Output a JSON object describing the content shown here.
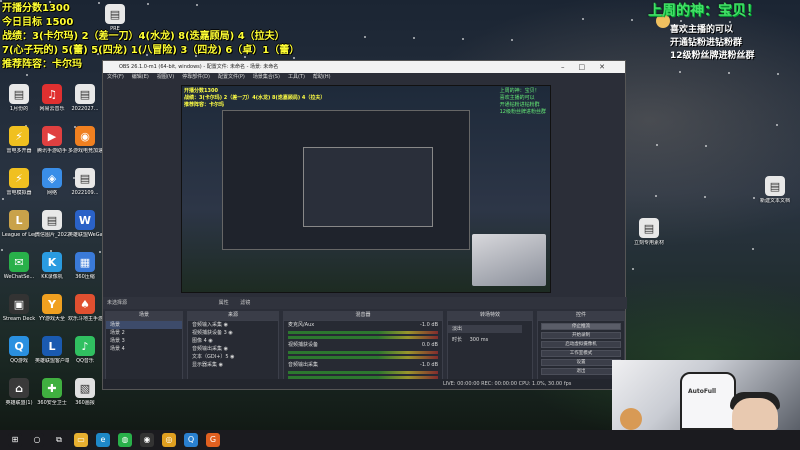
{
  "overlay": {
    "left_lines": [
      "开播分数1300",
      "今日目标 1500",
      "战绩：3(卡尔玛) 2（差一刀）4(水龙) 8(迭嘉顾局) 4（拉夫）",
      "7(心子玩的) 5(蕾) 5(四龙) 1(八冒险) 3（四龙) 6（卓）1（蕾）",
      "推荐阵容：卡尔玛"
    ],
    "right_title": "上周的神：宝贝！",
    "right_lines": [
      "喜欢主播的可以",
      "开通钻粉进钻粉群",
      "12级粉丝牌进粉丝群"
    ]
  },
  "desktop_icons": [
    {
      "label": "1月份的",
      "color": "#e8e8e8",
      "glyph": "▤"
    },
    {
      "label": "网易云音乐",
      "color": "#e03030",
      "glyph": "♫"
    },
    {
      "label": "2022027...",
      "color": "#e8e8e8",
      "glyph": "▤"
    },
    {
      "label": "雷电多开器",
      "color": "#f0c020",
      "glyph": "⚡"
    },
    {
      "label": "腾讯手游助手",
      "color": "#e04040",
      "glyph": "▶"
    },
    {
      "label": "多游戏电竞加速",
      "color": "#f08020",
      "glyph": "◉"
    },
    {
      "label": "雷电模拟器",
      "color": "#f0c020",
      "glyph": "⚡"
    },
    {
      "label": "网络",
      "color": "#3a8ee8",
      "glyph": "◈"
    },
    {
      "label": "2022109...",
      "color": "#e8e8e8",
      "glyph": "▤"
    },
    {
      "label": "League of Legends",
      "color": "#c9a24a",
      "glyph": "L"
    },
    {
      "label": "微信图片_20220...",
      "color": "#e8e8e8",
      "glyph": "▤"
    },
    {
      "label": "英雄联盟WeGame版",
      "color": "#2a62c8",
      "glyph": "W"
    },
    {
      "label": "WeChatSe...",
      "color": "#29b04a",
      "glyph": "✉"
    },
    {
      "label": "KK录像机",
      "color": "#2a9be0",
      "glyph": "K"
    },
    {
      "label": "360压缩",
      "color": "#3a7ad8",
      "glyph": "▦"
    },
    {
      "label": "Stream Deck",
      "color": "#333333",
      "glyph": "▣"
    },
    {
      "label": "YY游戏大全",
      "color": "#f0a020",
      "glyph": "Y"
    },
    {
      "label": "欢乐斗地主手游电脑版",
      "color": "#e05030",
      "glyph": "♠"
    },
    {
      "label": "QQ游戏",
      "color": "#2a90e0",
      "glyph": "Q"
    },
    {
      "label": "英雄联盟客户端",
      "color": "#1a5ab0",
      "glyph": "L"
    },
    {
      "label": "QQ音乐",
      "color": "#30c060",
      "glyph": "♪"
    },
    {
      "label": "英雄联盟(1)",
      "color": "#3a3a3a",
      "glyph": "⌂"
    },
    {
      "label": "360安全卫士",
      "color": "#40b040",
      "glyph": "✚"
    },
    {
      "label": "360画报",
      "color": "#e0e0e0",
      "glyph": "▧"
    }
  ],
  "desktop_icons_right": [
    {
      "label": "PRE",
      "color": "#e8e8e8",
      "glyph": "▤"
    },
    {
      "label": "新建文本文档",
      "color": "#e8e8e8",
      "glyph": "▤"
    },
    {
      "label": "立刻专用素材",
      "color": "#e8e8e8",
      "glyph": "▤"
    }
  ],
  "obs": {
    "title": "OBS 26.1.0-m1 (64-bit, windows) - 配置文件: 未命名 - 场景: 未命名",
    "menu": [
      "文件(F)",
      "编辑(E)",
      "视图(V)",
      "停靠部件(D)",
      "配置文件(P)",
      "场景集合(S)",
      "工具(T)",
      "帮助(H)"
    ],
    "source_toolbar": "未选择源",
    "source_toolbar_buttons": [
      "属性",
      "滤镜"
    ],
    "docks": {
      "scenes_title": "场景",
      "sources_title": "来源",
      "mixer_title": "混音器",
      "transitions_title": "转场特效",
      "controls_title": "控件"
    },
    "scenes": [
      "场景",
      "场景 2",
      "场景 3",
      "场景 4"
    ],
    "sources": [
      "音频输入采集",
      "视频捕获设备 3",
      "图像 4",
      "音频输出采集",
      "文本（GDI+）5",
      "显示器采集"
    ],
    "mixer": [
      {
        "name": "麦克风/Aux",
        "level": "-1.0 dB"
      },
      {
        "name": "视频捕获设备",
        "level": "0.0 dB"
      },
      {
        "name": "音频输出采集",
        "level": "-1.0 dB"
      }
    ],
    "transition": {
      "name": "淡出",
      "duration_label": "时长",
      "duration": "300 ms"
    },
    "controls": [
      "停止推流",
      "开始录制",
      "启动虚拟摄像机",
      "工作室模式",
      "设置",
      "退出"
    ],
    "status": "LIVE: 00:00:00   REC: 00:00:00   CPU: 1.0%, 30.00 fps",
    "preview_overlay_left": [
      "开播分数1300",
      "战绩：3(卡尔玛) 2（差一刀）4(水龙) 8(迭嘉顾局) 4（拉夫）",
      "推荐阵容：卡尔玛"
    ],
    "preview_overlay_right": [
      "上周的神：宝贝！",
      "喜欢主播的可以",
      "开通钻粉进钻粉群",
      "12级粉丝牌进粉丝群"
    ]
  },
  "webcam": {
    "chair_brand": "AutoFull"
  },
  "taskbar": {
    "items": [
      {
        "name": "windows-start-icon",
        "glyph": "⊞",
        "color": "#1b1b1f"
      },
      {
        "name": "search-icon",
        "glyph": "○",
        "color": "#1b1b1f"
      },
      {
        "name": "task-view-icon",
        "glyph": "⧉",
        "color": "#1b1b1f"
      },
      {
        "name": "explorer-icon",
        "glyph": "▭",
        "color": "#e8b030"
      },
      {
        "name": "edge-icon",
        "glyph": "e",
        "color": "#1e88c8"
      },
      {
        "name": "wechat-icon",
        "glyph": "◍",
        "color": "#29b04a"
      },
      {
        "name": "obs-icon",
        "glyph": "◉",
        "color": "#333333"
      },
      {
        "name": "chrome-icon",
        "glyph": "◎",
        "color": "#e0a020"
      },
      {
        "name": "qq-icon",
        "glyph": "Q",
        "color": "#2a80d0"
      },
      {
        "name": "app-icon",
        "glyph": "G",
        "color": "#e06020"
      }
    ]
  },
  "colors": {
    "overlay_yellow": "#ffff33",
    "overlay_green": "#44dd66",
    "obs_bg": "#2b2e38"
  }
}
